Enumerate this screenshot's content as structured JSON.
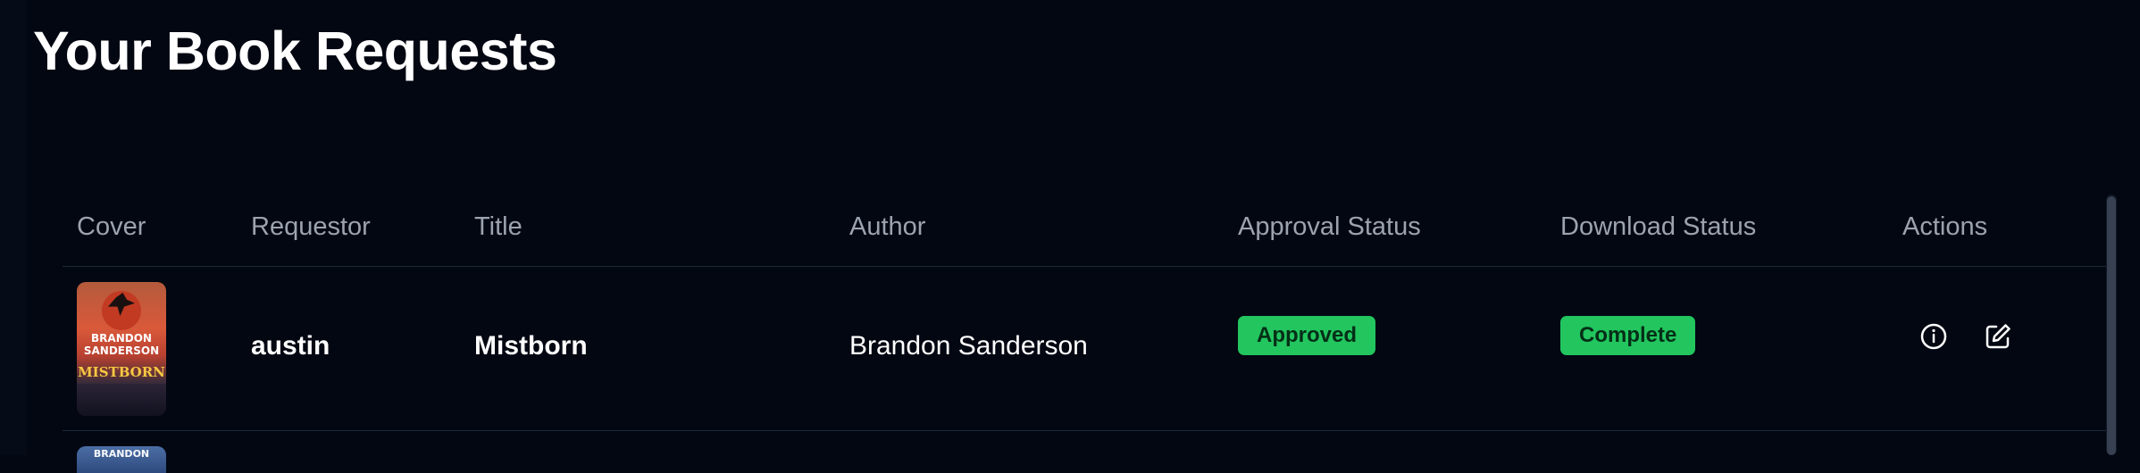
{
  "page": {
    "title": "Your Book Requests"
  },
  "table": {
    "columns": [
      "Cover",
      "Requestor",
      "Title",
      "Author",
      "Approval Status",
      "Download Status",
      "Actions"
    ],
    "rows": [
      {
        "cover": {
          "author_text": "BRANDON SANDERSON",
          "title_text": "MISTBORN"
        },
        "requestor": "austin",
        "title": "Mistborn",
        "author": "Brandon Sanderson",
        "approval_status": "Approved",
        "download_status": "Complete",
        "actions": {
          "info_icon": "info-icon",
          "edit_icon": "edit-icon"
        }
      }
    ],
    "next_row_cover_text": "BRANDON"
  },
  "colors": {
    "background": "#030712",
    "header_text": "#9ca3af",
    "badge_bg": "#22c55e",
    "badge_text": "#052e16",
    "divider": "#1f2937"
  }
}
